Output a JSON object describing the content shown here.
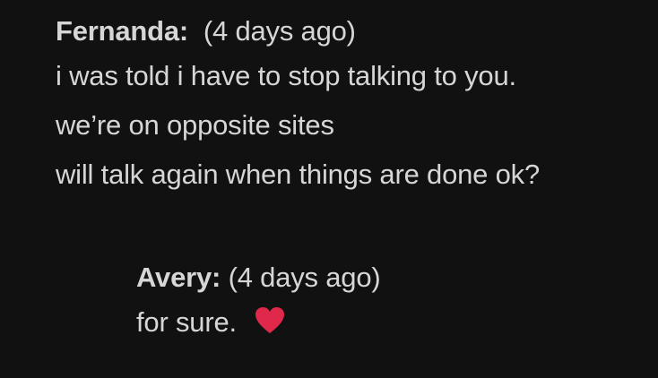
{
  "comments": [
    {
      "author": "Fernanda:",
      "timestamp": "(4 days ago)",
      "lines": [
        "i was told i have to stop talking to you.",
        "we’re on opposite sites",
        "will talk again when things are done ok?"
      ]
    },
    {
      "author": "Avery:",
      "timestamp": "(4 days ago)",
      "lines": [
        "for sure."
      ],
      "icon": "heart-icon"
    }
  ],
  "colors": {
    "background": "#111111",
    "text": "#d6d6d6",
    "heart": "#e0284a"
  }
}
